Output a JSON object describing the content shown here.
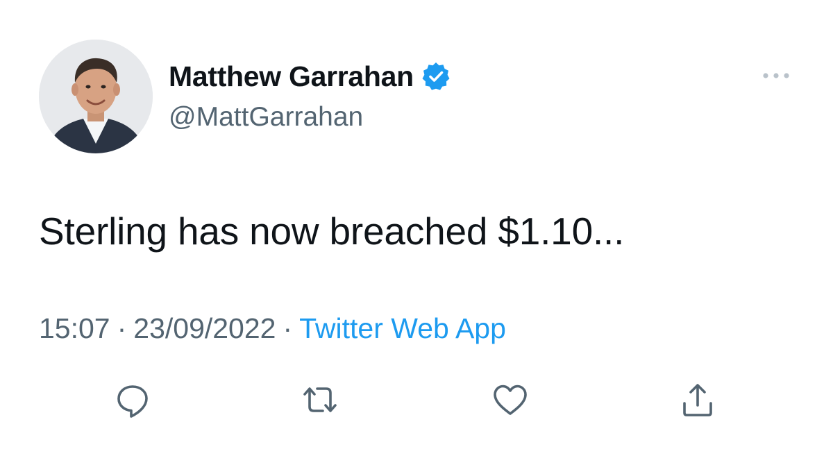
{
  "tweet": {
    "author": {
      "display_name": "Matthew Garrahan",
      "handle": "@MattGarrahan",
      "verified": true,
      "avatar_icon": "profile-photo"
    },
    "text": "Sterling has now breached $1.10...",
    "meta": {
      "time": "15:07",
      "separator": "·",
      "date": "23/09/2022",
      "source": "Twitter Web App"
    },
    "actions": [
      {
        "name": "reply",
        "icon": "speech-bubble-icon"
      },
      {
        "name": "retweet",
        "icon": "retweet-arrows-icon"
      },
      {
        "name": "like",
        "icon": "heart-icon"
      },
      {
        "name": "share",
        "icon": "share-upload-icon"
      }
    ]
  },
  "colors": {
    "text_primary": "#0f1419",
    "text_secondary": "#536471",
    "accent": "#1d9bf0"
  }
}
